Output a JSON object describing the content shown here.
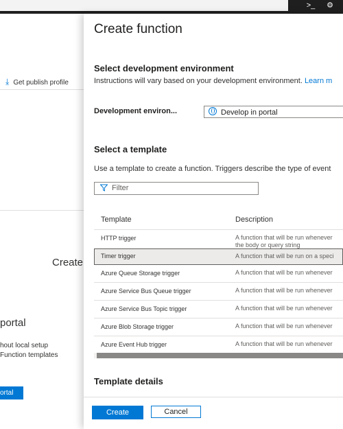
{
  "background_page": {
    "publish_label": "Get publish profile",
    "create_heading": "Create",
    "portal_heading": "portal",
    "line1": "hout local setup",
    "line2": "Function templates",
    "portal_button": "ortal"
  },
  "panel": {
    "title": "Create function",
    "dev_env": {
      "heading": "Select development environment",
      "instructions": "Instructions will vary based on your development environment.",
      "learn_more": "Learn m",
      "label": "Development environ...",
      "value": "Develop in portal"
    },
    "template_section": {
      "heading": "Select a template",
      "instructions": "Use a template to create a function. Triggers describe the type of event",
      "filter_placeholder": "Filter",
      "columns": [
        "Template",
        "Description"
      ],
      "rows": [
        {
          "template": "HTTP trigger",
          "description": "A function that will be run whenever",
          "description2": "the body or query string",
          "selected": false
        },
        {
          "template": "Timer trigger",
          "description": "A function that will be run on a speci",
          "selected": true
        },
        {
          "template": "Azure Queue Storage trigger",
          "description": "A function that will be run whenever",
          "selected": false
        },
        {
          "template": "Azure Service Bus Queue trigger",
          "description": "A function that will be run whenever",
          "selected": false
        },
        {
          "template": "Azure Service Bus Topic trigger",
          "description": "A function that will be run whenever",
          "selected": false
        },
        {
          "template": "Azure Blob Storage trigger",
          "description": "A function that will be run whenever",
          "selected": false
        },
        {
          "template": "Azure Event Hub trigger",
          "description": "A function that will be run whenever",
          "selected": false
        }
      ]
    },
    "template_details_heading": "Template details"
  },
  "footer": {
    "create_label": "Create",
    "cancel_label": "Cancel"
  }
}
